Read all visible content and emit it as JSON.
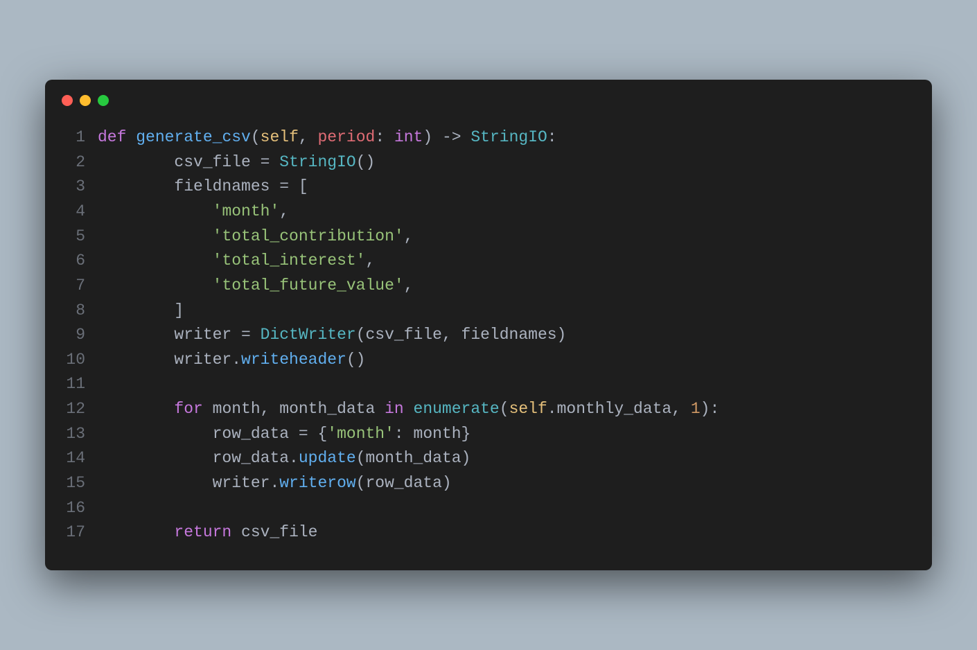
{
  "window": {
    "traffic_light_close": "close",
    "traffic_light_min": "minimize",
    "traffic_light_max": "zoom"
  },
  "code": {
    "lines": [
      {
        "num": "1",
        "tokens": [
          {
            "t": "def ",
            "c": "tok-kw"
          },
          {
            "t": "generate_csv",
            "c": "tok-fn"
          },
          {
            "t": "(",
            "c": "tok-punc"
          },
          {
            "t": "self",
            "c": "tok-self"
          },
          {
            "t": ", ",
            "c": "tok-punc"
          },
          {
            "t": "period",
            "c": "tok-param"
          },
          {
            "t": ": ",
            "c": "tok-punc"
          },
          {
            "t": "int",
            "c": "tok-type"
          },
          {
            "t": ") -> ",
            "c": "tok-punc"
          },
          {
            "t": "StringIO",
            "c": "tok-cls"
          },
          {
            "t": ":",
            "c": "tok-punc"
          }
        ]
      },
      {
        "num": "2",
        "tokens": [
          {
            "t": "        csv_file ",
            "c": "tok-default"
          },
          {
            "t": "=",
            "c": "tok-op"
          },
          {
            "t": " ",
            "c": "tok-default"
          },
          {
            "t": "StringIO",
            "c": "tok-cls"
          },
          {
            "t": "()",
            "c": "tok-punc"
          }
        ]
      },
      {
        "num": "3",
        "tokens": [
          {
            "t": "        fieldnames ",
            "c": "tok-default"
          },
          {
            "t": "=",
            "c": "tok-op"
          },
          {
            "t": " [",
            "c": "tok-punc"
          }
        ]
      },
      {
        "num": "4",
        "tokens": [
          {
            "t": "            ",
            "c": "tok-default"
          },
          {
            "t": "'month'",
            "c": "tok-str"
          },
          {
            "t": ",",
            "c": "tok-punc"
          }
        ]
      },
      {
        "num": "5",
        "tokens": [
          {
            "t": "            ",
            "c": "tok-default"
          },
          {
            "t": "'total_contribution'",
            "c": "tok-str"
          },
          {
            "t": ",",
            "c": "tok-punc"
          }
        ]
      },
      {
        "num": "6",
        "tokens": [
          {
            "t": "            ",
            "c": "tok-default"
          },
          {
            "t": "'total_interest'",
            "c": "tok-str"
          },
          {
            "t": ",",
            "c": "tok-punc"
          }
        ]
      },
      {
        "num": "7",
        "tokens": [
          {
            "t": "            ",
            "c": "tok-default"
          },
          {
            "t": "'total_future_value'",
            "c": "tok-str"
          },
          {
            "t": ",",
            "c": "tok-punc"
          }
        ]
      },
      {
        "num": "8",
        "tokens": [
          {
            "t": "        ]",
            "c": "tok-punc"
          }
        ]
      },
      {
        "num": "9",
        "tokens": [
          {
            "t": "        writer ",
            "c": "tok-default"
          },
          {
            "t": "=",
            "c": "tok-op"
          },
          {
            "t": " ",
            "c": "tok-default"
          },
          {
            "t": "DictWriter",
            "c": "tok-cls"
          },
          {
            "t": "(csv_file, fieldnames)",
            "c": "tok-punc"
          }
        ]
      },
      {
        "num": "10",
        "tokens": [
          {
            "t": "        writer.",
            "c": "tok-default"
          },
          {
            "t": "writeheader",
            "c": "tok-fn"
          },
          {
            "t": "()",
            "c": "tok-punc"
          }
        ]
      },
      {
        "num": "11",
        "tokens": [
          {
            "t": "",
            "c": "tok-default"
          }
        ]
      },
      {
        "num": "12",
        "tokens": [
          {
            "t": "        ",
            "c": "tok-default"
          },
          {
            "t": "for",
            "c": "tok-kw"
          },
          {
            "t": " month, month_data ",
            "c": "tok-default"
          },
          {
            "t": "in",
            "c": "tok-kw"
          },
          {
            "t": " ",
            "c": "tok-default"
          },
          {
            "t": "enumerate",
            "c": "tok-builtin"
          },
          {
            "t": "(",
            "c": "tok-punc"
          },
          {
            "t": "self",
            "c": "tok-self"
          },
          {
            "t": ".monthly_data, ",
            "c": "tok-default"
          },
          {
            "t": "1",
            "c": "tok-num"
          },
          {
            "t": "):",
            "c": "tok-punc"
          }
        ]
      },
      {
        "num": "13",
        "tokens": [
          {
            "t": "            row_data ",
            "c": "tok-default"
          },
          {
            "t": "=",
            "c": "tok-op"
          },
          {
            "t": " {",
            "c": "tok-punc"
          },
          {
            "t": "'month'",
            "c": "tok-str"
          },
          {
            "t": ": month}",
            "c": "tok-punc"
          }
        ]
      },
      {
        "num": "14",
        "tokens": [
          {
            "t": "            row_data.",
            "c": "tok-default"
          },
          {
            "t": "update",
            "c": "tok-fn"
          },
          {
            "t": "(month_data)",
            "c": "tok-punc"
          }
        ]
      },
      {
        "num": "15",
        "tokens": [
          {
            "t": "            writer.",
            "c": "tok-default"
          },
          {
            "t": "writerow",
            "c": "tok-fn"
          },
          {
            "t": "(row_data)",
            "c": "tok-punc"
          }
        ]
      },
      {
        "num": "16",
        "tokens": [
          {
            "t": "",
            "c": "tok-default"
          }
        ]
      },
      {
        "num": "17",
        "tokens": [
          {
            "t": "        ",
            "c": "tok-default"
          },
          {
            "t": "return",
            "c": "tok-kw"
          },
          {
            "t": " csv_file",
            "c": "tok-default"
          }
        ]
      }
    ]
  }
}
